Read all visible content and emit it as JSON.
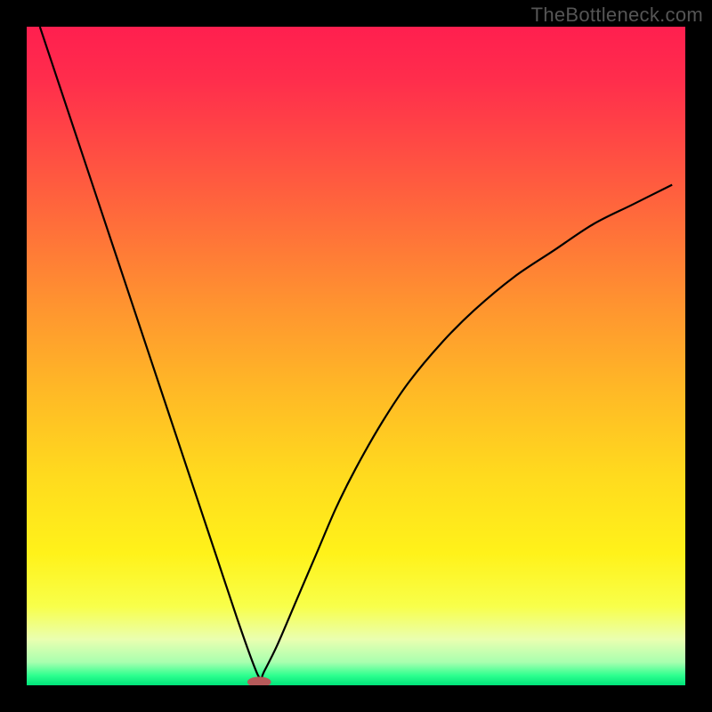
{
  "watermark": "TheBottleneck.com",
  "chart_data": {
    "type": "line",
    "title": "",
    "xlabel": "",
    "ylabel": "",
    "xlim": [
      0,
      1
    ],
    "ylim": [
      0,
      1
    ],
    "gradient_stops": [
      {
        "offset": 0.0,
        "color": "#ff1f4f"
      },
      {
        "offset": 0.08,
        "color": "#ff2d4c"
      },
      {
        "offset": 0.18,
        "color": "#ff4a44"
      },
      {
        "offset": 0.3,
        "color": "#ff6e3a"
      },
      {
        "offset": 0.42,
        "color": "#ff9330"
      },
      {
        "offset": 0.55,
        "color": "#ffb826"
      },
      {
        "offset": 0.68,
        "color": "#ffda1e"
      },
      {
        "offset": 0.8,
        "color": "#fff21a"
      },
      {
        "offset": 0.88,
        "color": "#f8ff4a"
      },
      {
        "offset": 0.93,
        "color": "#eaffb0"
      },
      {
        "offset": 0.965,
        "color": "#a8ffaf"
      },
      {
        "offset": 0.985,
        "color": "#2eff8f"
      },
      {
        "offset": 1.0,
        "color": "#00e47a"
      }
    ],
    "series": [
      {
        "name": "bottleneck-curve",
        "x": [
          0.02,
          0.05,
          0.08,
          0.11,
          0.14,
          0.17,
          0.2,
          0.23,
          0.26,
          0.29,
          0.32,
          0.345,
          0.355,
          0.36,
          0.38,
          0.41,
          0.44,
          0.47,
          0.5,
          0.54,
          0.58,
          0.63,
          0.68,
          0.74,
          0.8,
          0.86,
          0.92,
          0.98
        ],
        "y": [
          1.0,
          0.91,
          0.82,
          0.73,
          0.64,
          0.55,
          0.46,
          0.37,
          0.28,
          0.19,
          0.1,
          0.03,
          0.01,
          0.02,
          0.06,
          0.13,
          0.2,
          0.27,
          0.33,
          0.4,
          0.46,
          0.52,
          0.57,
          0.62,
          0.66,
          0.7,
          0.73,
          0.76
        ]
      }
    ],
    "marker": {
      "x": 0.353,
      "y": 0.005,
      "rx": 0.018,
      "ry": 0.008,
      "color": "#b65a5a"
    }
  }
}
